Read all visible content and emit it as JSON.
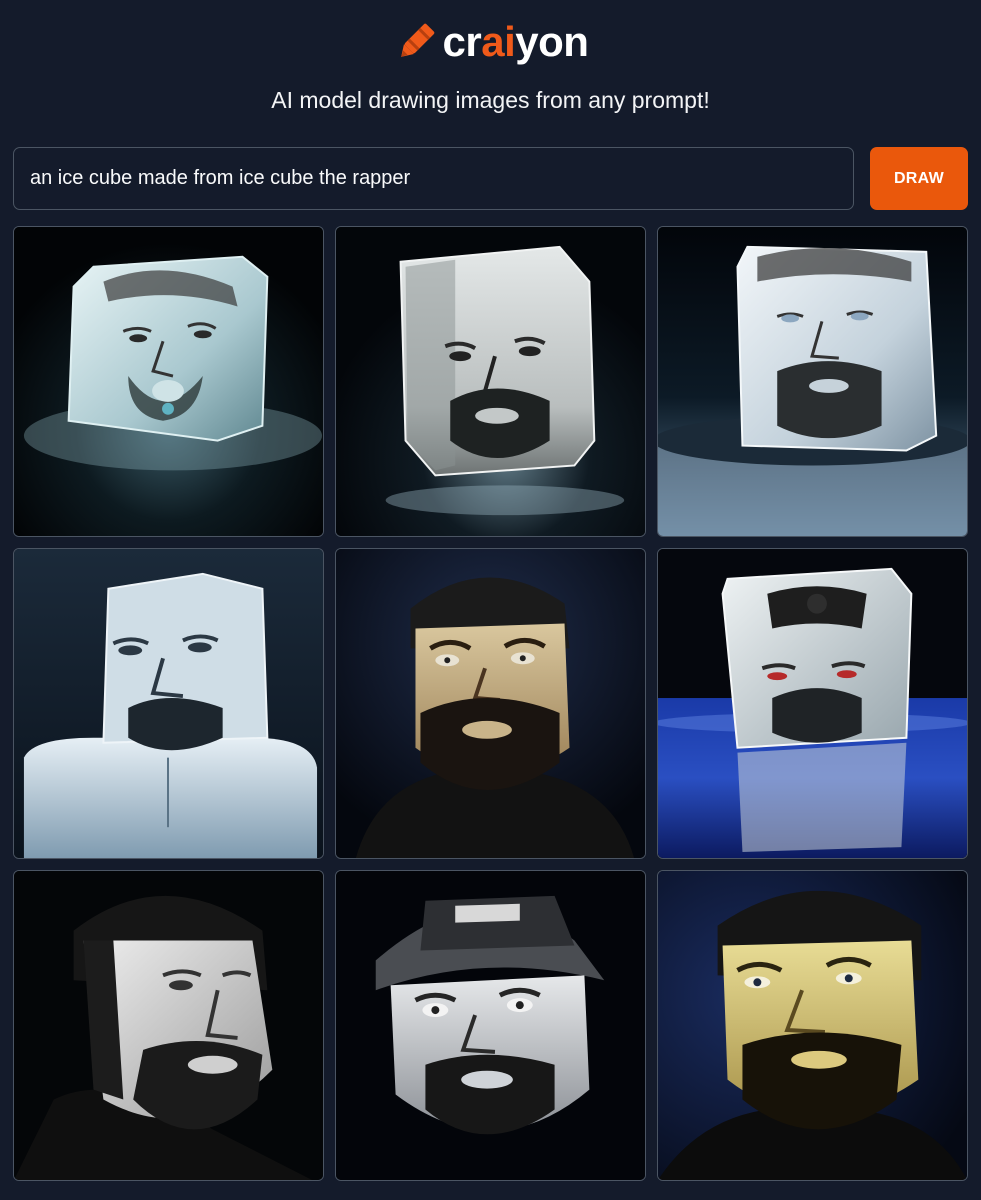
{
  "brand": {
    "name_prefix": "cr",
    "name_accent": "ai",
    "name_suffix": "yon",
    "icon": "crayon-icon",
    "accent_color": "#f05a1a"
  },
  "tagline": "AI model drawing images from any prompt!",
  "search": {
    "value": "an ice cube made from ice cube the rapper"
  },
  "draw_button": {
    "label": "DRAW",
    "color": "#ea580c"
  },
  "results": {
    "count": 9,
    "images": [
      {
        "style": "ice-cube-face",
        "tone": "#cfe3e6"
      },
      {
        "style": "ice-cube-face",
        "tone": "#d9dddc"
      },
      {
        "style": "ice-cube-face",
        "tone": "#dbe4ec"
      },
      {
        "style": "ice-cube-face",
        "tone": "#c9d8e0"
      },
      {
        "style": "portrait",
        "tone": "#c9b48a"
      },
      {
        "style": "ice-cube-face",
        "tone": "#d3dbe0"
      },
      {
        "style": "portrait",
        "tone": "#d8d8d8"
      },
      {
        "style": "portrait-cap",
        "tone": "#cfd3d8"
      },
      {
        "style": "portrait",
        "tone": "#dcc97e"
      }
    ]
  }
}
